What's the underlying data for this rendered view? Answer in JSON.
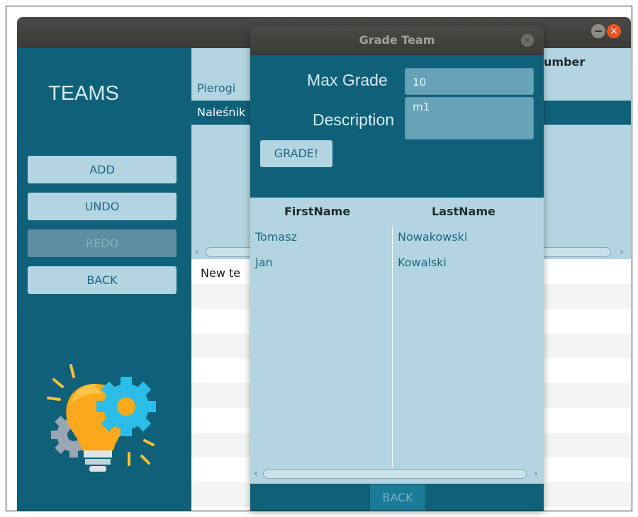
{
  "main_window": {
    "sidebar": {
      "title": "TEAMS",
      "buttons": [
        {
          "label": "ADD",
          "enabled": true
        },
        {
          "label": "UNDO",
          "enabled": true
        },
        {
          "label": "REDO",
          "enabled": false
        },
        {
          "label": "BACK",
          "enabled": true
        }
      ],
      "illustration_icon": "lightbulb-gears-icon"
    },
    "teams_table": {
      "visible_column_header_fragment": "umber",
      "rows": [
        {
          "name": "Pierogi",
          "selected": false
        },
        {
          "name": "Naleśnik",
          "selected": true
        }
      ]
    },
    "lower_list": {
      "first_item_fragment": "New te"
    }
  },
  "dialog": {
    "title": "Grade Team",
    "max_grade_label": "Max Grade",
    "max_grade_value": "10",
    "description_label": "Description",
    "description_value": "m1",
    "grade_button": "GRADE!",
    "students_table": {
      "columns": [
        "FirstName",
        "LastName"
      ],
      "rows": [
        {
          "first": "Tomasz",
          "last": "Nowakowski"
        },
        {
          "first": "Jan",
          "last": "Kowalski"
        }
      ]
    },
    "back_button": "BACK"
  },
  "colors": {
    "primary": "#0f6079",
    "light": "#b3d5e1",
    "titlebar": "#3b3a37",
    "close_accent": "#e95420"
  }
}
